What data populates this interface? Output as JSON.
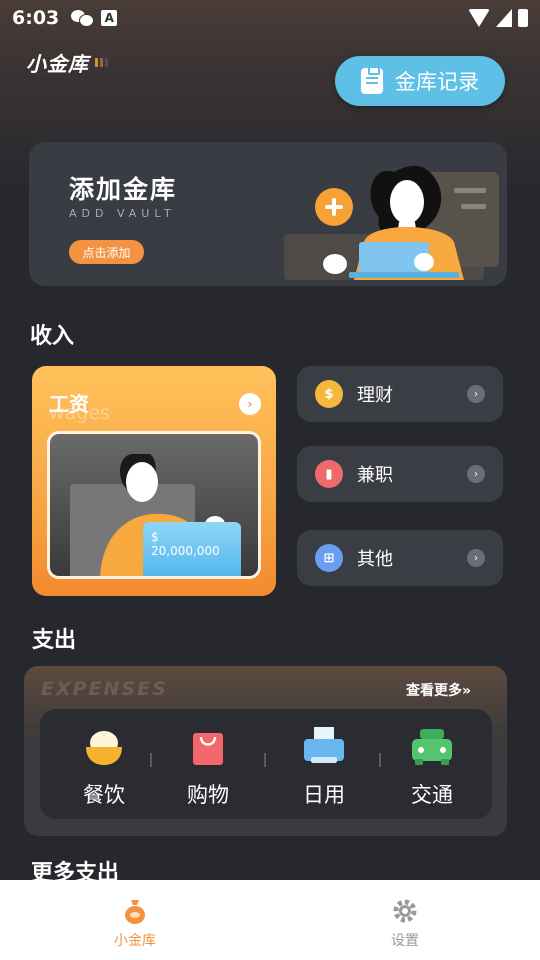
{
  "status_bar": {
    "time": "6:03",
    "a_icon_label": "A"
  },
  "header": {
    "logo_text": "小金库",
    "record_button_label": "金库记录"
  },
  "vault_card": {
    "title": "添加金库",
    "subtitle": "ADD VAULT",
    "button_label": "点击添加"
  },
  "income": {
    "section_title": "收入",
    "wages_card": {
      "title": "工资",
      "subtitle": "wages",
      "amount_symbol": "$",
      "amount": "20,000,000"
    },
    "items": [
      {
        "label": "理财",
        "icon": "coin-icon",
        "color": "#f5b83b"
      },
      {
        "label": "兼职",
        "icon": "briefcase-icon",
        "color": "#ef6a6a"
      },
      {
        "label": "其他",
        "icon": "grid-icon",
        "color": "#6a9ef0"
      }
    ]
  },
  "expense": {
    "section_title": "支出",
    "bg_text": "EXPENSES",
    "more_link": "查看更多»",
    "items": [
      {
        "label": "餐饮",
        "icon": "food-bowl-icon"
      },
      {
        "label": "购物",
        "icon": "shopping-bag-icon"
      },
      {
        "label": "日用",
        "icon": "printer-icon"
      },
      {
        "label": "交通",
        "icon": "car-icon"
      }
    ]
  },
  "more_expense": {
    "section_title": "更多支出"
  },
  "tab_bar": {
    "tabs": [
      {
        "label": "小金库",
        "icon": "money-bag-icon",
        "active": true,
        "color": "#f39342"
      },
      {
        "label": "设置",
        "icon": "gear-icon",
        "active": false,
        "color": "#9a9a9a"
      }
    ]
  }
}
